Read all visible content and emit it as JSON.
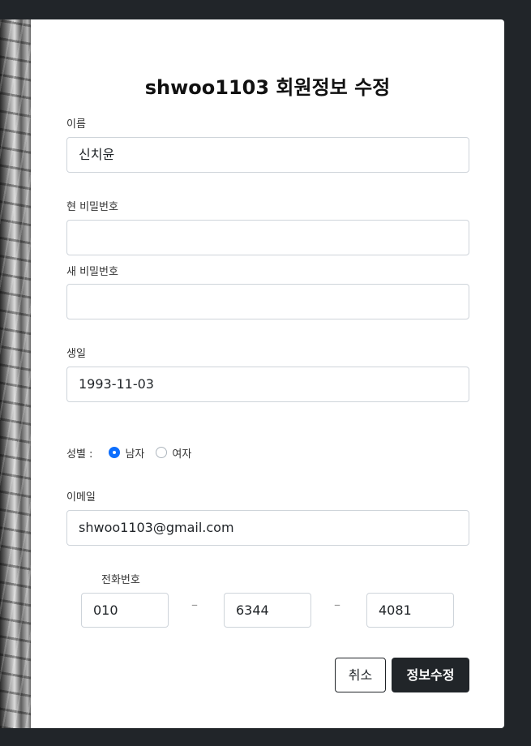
{
  "form": {
    "title": "shwoo1103 회원정보 수정",
    "name": {
      "label": "이름",
      "value": "신치윤"
    },
    "current_password": {
      "label": "현 비밀번호",
      "value": ""
    },
    "new_password": {
      "label": "새 비밀번호",
      "value": ""
    },
    "birthday": {
      "label": "생일",
      "value": "1993-11-03"
    },
    "gender": {
      "label": "성별 :",
      "options": [
        {
          "label": "남자",
          "checked": true
        },
        {
          "label": "여자",
          "checked": false
        }
      ]
    },
    "email": {
      "label": "이메일",
      "value": "shwoo1103@gmail.com"
    },
    "phone": {
      "label": "전화번호",
      "part1": "010",
      "separator1": "–",
      "part2": "6344",
      "separator2": "–",
      "part3": "4081"
    },
    "buttons": {
      "cancel": "취소",
      "submit": "정보수정"
    }
  },
  "colors": {
    "page_bg": "#212529",
    "modal_bg": "#ffffff",
    "accent": "#0d6efd",
    "primary_button": "#212529"
  }
}
